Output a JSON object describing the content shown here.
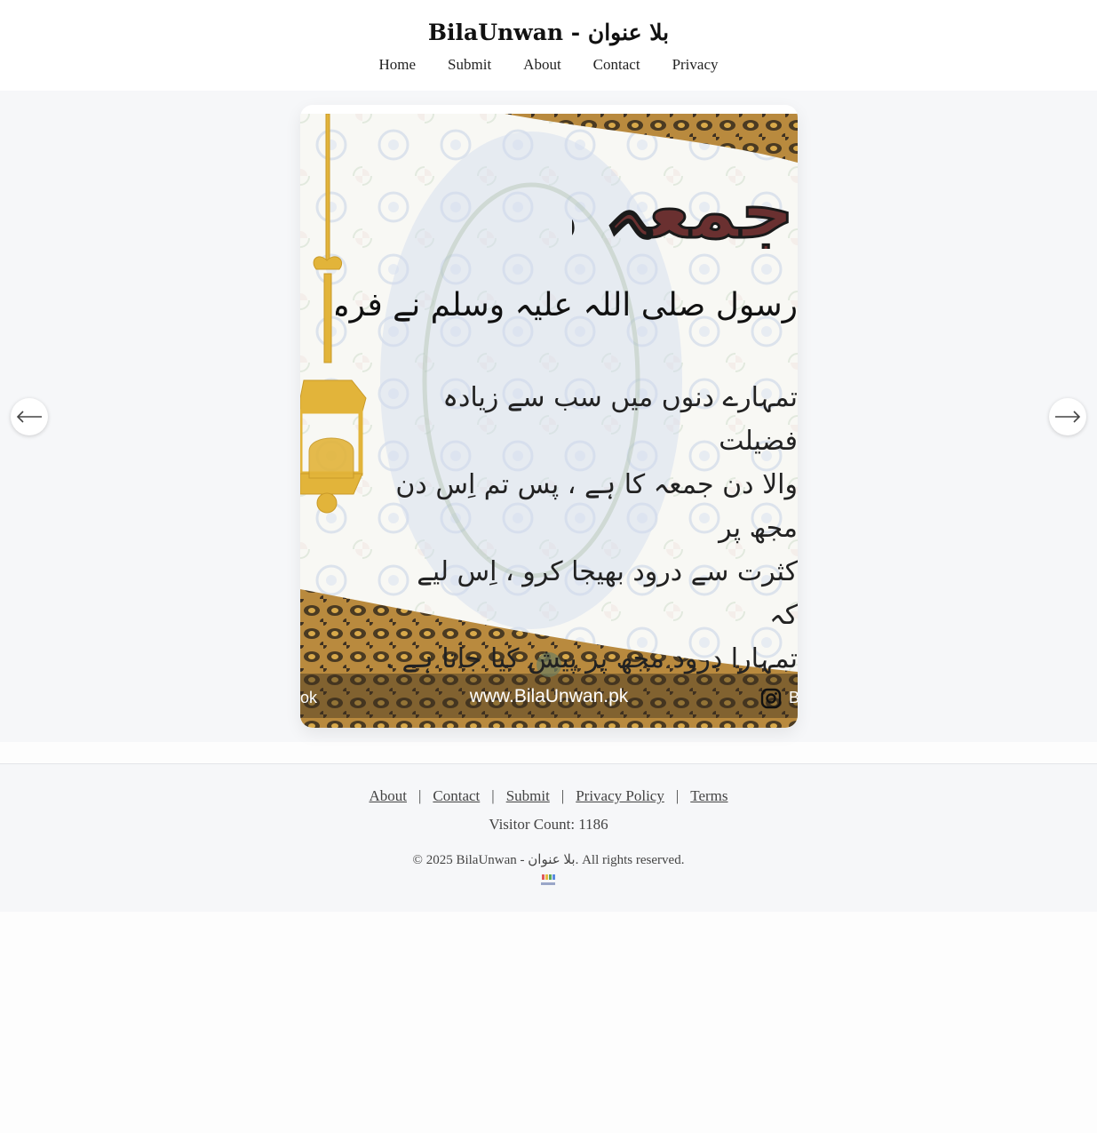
{
  "site": {
    "title": "BilaUnwan - بلا عنوان"
  },
  "nav": {
    "items": [
      "Home",
      "Submit",
      "About",
      "Contact",
      "Privacy"
    ]
  },
  "carousel": {
    "prev_icon": "arrow-left-icon",
    "next_icon": "arrow-right-icon",
    "slide": {
      "heading": "جمعہ مبارک",
      "subheading": "رسول صلی اللہ علیہ وسلم نے فرمایا:",
      "body": "تمہارے دنوں میں سب سے زیادہ فضیلت\nوالا دن جمعہ کا ہے ، پس تم اِس دن مجھ پر\nکثرت سے درود بھیجا کرو ، اِس لیے کہ\nتمہارا درود مجھ پر پیش کیا جاتا ہے .",
      "website": "www.BilaUnwan.pk",
      "left_edge_text": "ok",
      "right_edge_text": "B",
      "social_icon": "instagram-icon"
    }
  },
  "footer": {
    "links": [
      "About",
      "Contact",
      "Submit",
      "Privacy Policy",
      "Terms"
    ],
    "separator": "|",
    "visitor_count": "Visitor Count: 1186",
    "copyright": "© 2025 BilaUnwan - بلا عنوان. All rights reserved."
  },
  "colors": {
    "background": "#f6f7f9",
    "heading_maroon": "#6a3030",
    "lantern_gold": "#e2b43a",
    "border_brown": "#8a5a22"
  }
}
